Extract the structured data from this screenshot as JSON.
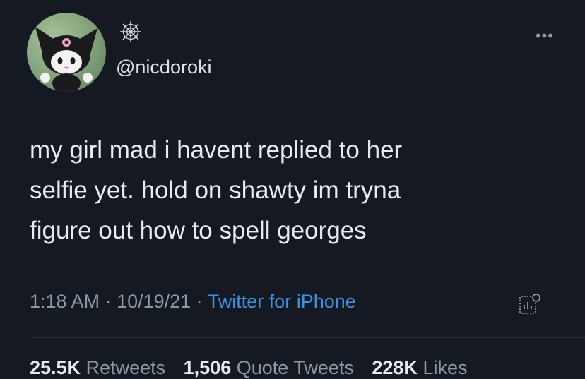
{
  "user": {
    "handle": "@nicdoroki",
    "display_name_icon": "spiderweb-icon",
    "avatar": "avatar"
  },
  "tweet": {
    "text": "my girl mad i havent replied to her\nselfie yet. hold on shawty im tryna\nfigure out how to spell georges"
  },
  "meta": {
    "time": "1:18 AM",
    "separator": " · ",
    "date": "10/19/21",
    "source": "Twitter for iPhone"
  },
  "stats": {
    "retweets_count": "25.5K",
    "retweets_label": "Retweets",
    "quotes_count": "1,506",
    "quotes_label": "Quote Tweets",
    "likes_count": "228K",
    "likes_label": "Likes"
  },
  "icons": {
    "more": "more-icon",
    "analytics": "analytics-icon"
  },
  "colors": {
    "background": "#151a22",
    "text": "#e9ecef",
    "secondary": "#8b98a5",
    "link": "#3a91df"
  }
}
